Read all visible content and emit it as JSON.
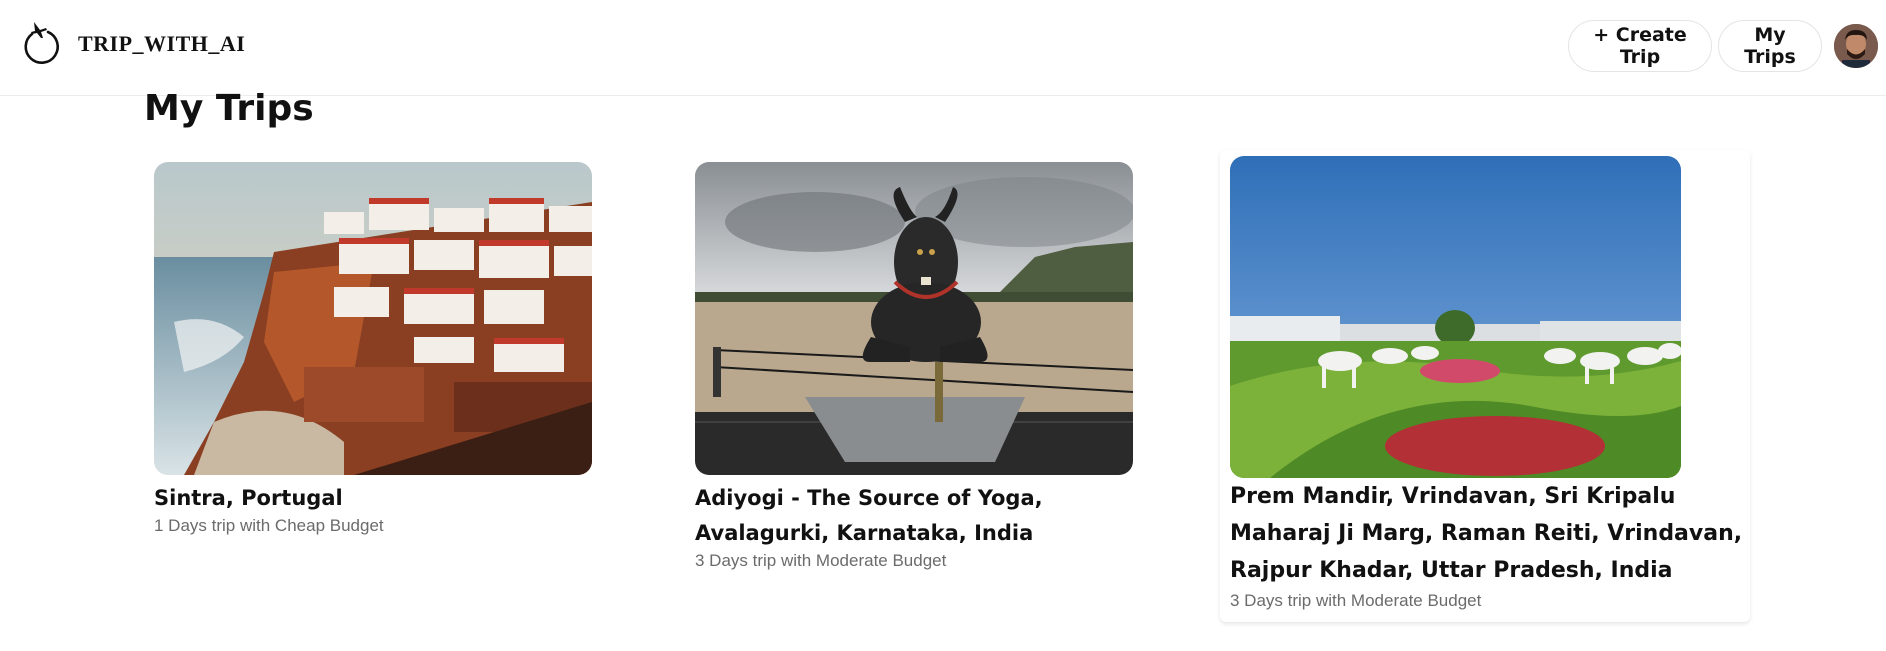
{
  "navbar": {
    "brand": "TRIP_WITH_AI",
    "create_trip_label": "+ Create Trip",
    "my_trips_label": "My Trips",
    "logo_icon": "plane-orbit-icon",
    "avatar_icon": "user-avatar"
  },
  "page": {
    "title": "My Trips"
  },
  "trips": [
    {
      "place": "Sintra, Portugal",
      "meta": "1 Days trip with Cheap Budget",
      "image": "coastal-cliff-town-photo"
    },
    {
      "place": "Adiyogi - The Source of Yoga, Avalagurki, Karnataka, India",
      "meta": "3 Days trip with Moderate Budget",
      "image": "nandi-statue-photo"
    },
    {
      "place": "Prem Mandir, Vrindavan, Sri Kripalu Maharaj Ji Marg, Raman Reiti, Vrindavan, Rajpur Khadar, Uttar Pradesh, India",
      "meta": "3 Days trip with Moderate Budget",
      "image": "temple-garden-cows-photo"
    }
  ]
}
